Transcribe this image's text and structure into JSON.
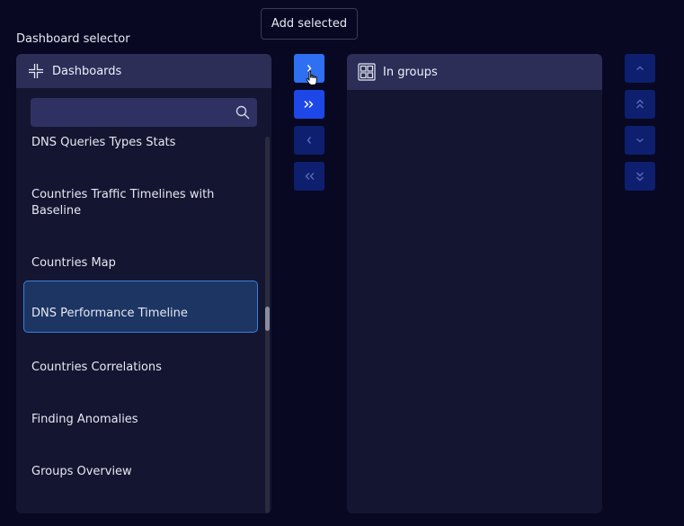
{
  "tooltip": "Add selected",
  "selector_label": "Dashboard selector",
  "left_panel": {
    "title": "Dashboards",
    "icon": "dashboards-icon",
    "search": {
      "value": "",
      "placeholder": ""
    },
    "items": [
      {
        "label": "DNS Queries Types Stats",
        "selected": false
      },
      {
        "label": "Countries Traffic Timelines with Baseline",
        "selected": false
      },
      {
        "label": "Countries Map",
        "selected": false
      },
      {
        "label": "DNS Performance Timeline",
        "selected": true
      },
      {
        "label": "Countries Correlations",
        "selected": false
      },
      {
        "label": "Finding Anomalies",
        "selected": false
      },
      {
        "label": "Groups Overview",
        "selected": false
      }
    ]
  },
  "right_panel": {
    "title": "In groups",
    "icon": "groups-icon",
    "items": []
  },
  "transfer_buttons": [
    {
      "name": "add-selected-button",
      "icon": "chevron-right-icon",
      "state": "hover"
    },
    {
      "name": "add-all-button",
      "icon": "double-chevron-right-icon",
      "state": "active"
    },
    {
      "name": "remove-selected-button",
      "icon": "chevron-left-icon",
      "state": "disabled"
    },
    {
      "name": "remove-all-button",
      "icon": "double-chevron-left-icon",
      "state": "disabled"
    }
  ],
  "order_buttons": [
    {
      "name": "move-up-button",
      "icon": "chevron-up-icon",
      "state": "disabled"
    },
    {
      "name": "move-top-button",
      "icon": "double-chevron-up-icon",
      "state": "disabled"
    },
    {
      "name": "move-down-button",
      "icon": "chevron-down-icon",
      "state": "disabled"
    },
    {
      "name": "move-bottom-button",
      "icon": "double-chevron-down-icon",
      "state": "disabled"
    }
  ],
  "colors": {
    "background": "#080822",
    "panel": "#141530",
    "panel_header": "#2c2e58",
    "selected_item": "#1c3563",
    "selected_border": "#3f7fd8",
    "button_active": "#1e47e8",
    "button_hover": "#2f6ff2",
    "button_disabled": "#0d1f6e"
  }
}
